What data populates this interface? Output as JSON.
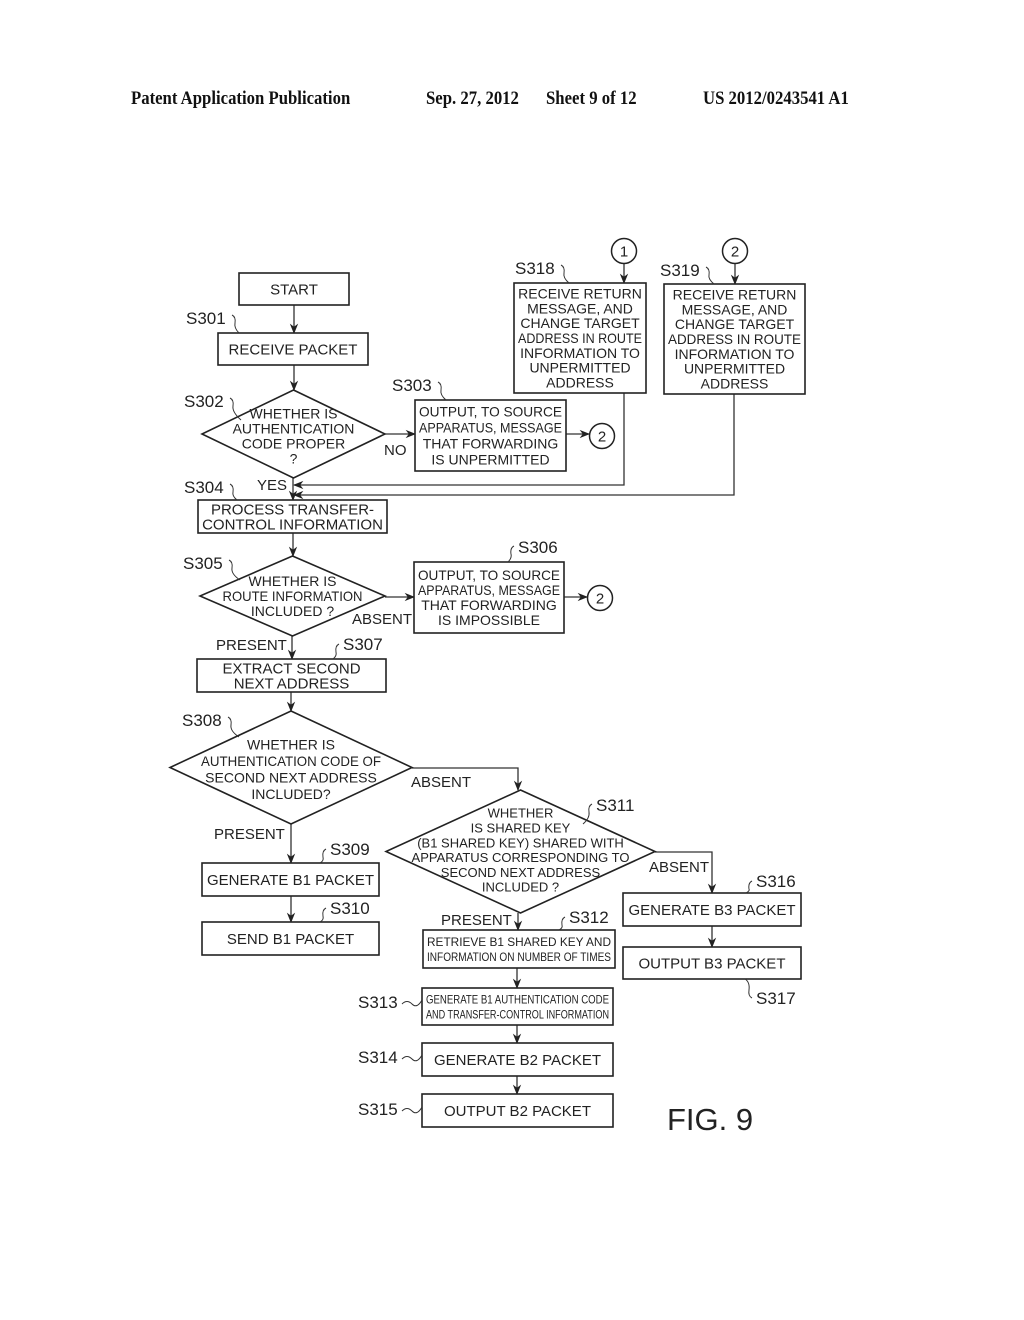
{
  "header": {
    "publication": "Patent Application Publication",
    "date": "Sep. 27, 2012",
    "sheet": "Sheet 9 of 12",
    "number": "US 2012/0243541 A1"
  },
  "figure_label": "FIG. 9",
  "nodes": {
    "start": {
      "lines": [
        "START"
      ]
    },
    "s301": {
      "label": "S301",
      "lines": [
        "RECEIVE PACKET"
      ]
    },
    "s302": {
      "label": "S302",
      "lines": [
        "WHETHER IS",
        "AUTHENTICATION",
        "CODE PROPER",
        "?"
      ]
    },
    "s303": {
      "label": "S303",
      "lines": [
        "OUTPUT, TO SOURCE",
        "APPARATUS, MESSAGE",
        "THAT FORWARDING",
        "IS UNPERMITTED"
      ]
    },
    "s304": {
      "label": "S304",
      "lines": [
        "PROCESS TRANSFER-",
        "CONTROL INFORMATION"
      ]
    },
    "s305": {
      "label": "S305",
      "lines": [
        "WHETHER IS",
        "ROUTE INFORMATION",
        "INCLUDED ?"
      ]
    },
    "s306": {
      "label": "S306",
      "lines": [
        "OUTPUT, TO SOURCE",
        "APPARATUS, MESSAGE",
        "THAT FORWARDING",
        "IS IMPOSSIBLE"
      ]
    },
    "s307": {
      "label": "S307",
      "lines": [
        "EXTRACT SECOND",
        "NEXT ADDRESS"
      ]
    },
    "s308": {
      "label": "S308",
      "lines": [
        "WHETHER IS",
        "AUTHENTICATION CODE OF",
        "SECOND NEXT ADDRESS",
        "INCLUDED?"
      ]
    },
    "s309": {
      "label": "S309",
      "lines": [
        "GENERATE B1 PACKET"
      ]
    },
    "s310": {
      "label": "S310",
      "lines": [
        "SEND B1 PACKET"
      ]
    },
    "s311": {
      "label": "S311",
      "lines": [
        "WHETHER",
        "IS SHARED KEY",
        "(B1 SHARED KEY) SHARED WITH",
        "APPARATUS CORRESPONDING TO",
        "SECOND NEXT ADDRESS",
        "INCLUDED ?"
      ]
    },
    "s312": {
      "label": "S312",
      "lines": [
        "RETRIEVE B1 SHARED KEY AND",
        "INFORMATION ON NUMBER OF TIMES"
      ]
    },
    "s313": {
      "label": "S313",
      "lines": [
        "GENERATE B1 AUTHENTICATION CODE",
        "AND TRANSFER-CONTROL INFORMATION"
      ]
    },
    "s314": {
      "label": "S314",
      "lines": [
        "GENERATE B2 PACKET"
      ]
    },
    "s315": {
      "label": "S315",
      "lines": [
        "OUTPUT B2 PACKET"
      ]
    },
    "s316": {
      "label": "S316",
      "lines": [
        "GENERATE B3 PACKET"
      ]
    },
    "s317": {
      "label": "S317",
      "lines": [
        "OUTPUT B3 PACKET"
      ]
    },
    "s318": {
      "label": "S318",
      "lines": [
        "RECEIVE RETURN",
        "MESSAGE, AND",
        "CHANGE TARGET",
        "ADDRESS IN ROUTE",
        "INFORMATION TO",
        "UNPERMITTED",
        "ADDRESS"
      ]
    },
    "s319": {
      "label": "S319",
      "lines": [
        "RECEIVE RETURN",
        "MESSAGE, AND",
        "CHANGE TARGET",
        "ADDRESS IN ROUTE",
        "INFORMATION TO",
        "UNPERMITTED",
        "ADDRESS"
      ]
    }
  },
  "connectors": {
    "one": "1",
    "two": "2"
  },
  "edge_labels": {
    "no": "NO",
    "yes": "YES",
    "absent": "ABSENT",
    "present": "PRESENT"
  }
}
